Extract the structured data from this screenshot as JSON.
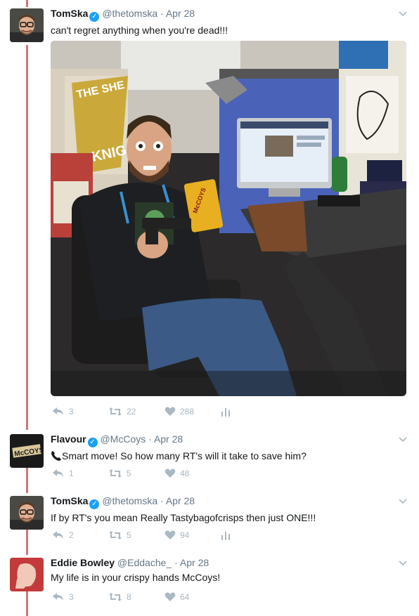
{
  "tweets": [
    {
      "name": "TomSka",
      "handle": "@thetomska",
      "separator": "·",
      "date": "Apr 28",
      "text": "can't regret anything when you're dead!!!",
      "replies": "3",
      "retweets": "22",
      "likes": "288",
      "verified": true
    },
    {
      "name": "Flavour",
      "handle": "@McCoys",
      "separator": "·",
      "date": "Apr 28",
      "text": "Smart move! So how many RT's will it take to save him?",
      "replies": "1",
      "retweets": "5",
      "likes": "48",
      "verified": true,
      "avatar_text": "McCOYS"
    },
    {
      "name": "TomSka",
      "handle": "@thetomska",
      "separator": "·",
      "date": "Apr 28",
      "text": "If by RT's you mean Really Tastybagofcrisps then just ONE!!!",
      "replies": "2",
      "retweets": "5",
      "likes": "94",
      "verified": true
    },
    {
      "name": "Eddie Bowley",
      "handle": "@Eddache_",
      "separator": "·",
      "date": "Apr 28",
      "text": "My life is in your crispy hands McCoys!",
      "replies": "3",
      "retweets": "8",
      "likes": "64",
      "verified": false
    }
  ],
  "photo": {
    "poster_text": "KNIG",
    "poster_top_text": "THE SHE",
    "bag_text": "McCOYS"
  },
  "colors": {
    "thread_line": "#c9777b",
    "verified": "#1da1f2",
    "action_gray": "#aab8c2",
    "meta_gray": "#657786"
  }
}
